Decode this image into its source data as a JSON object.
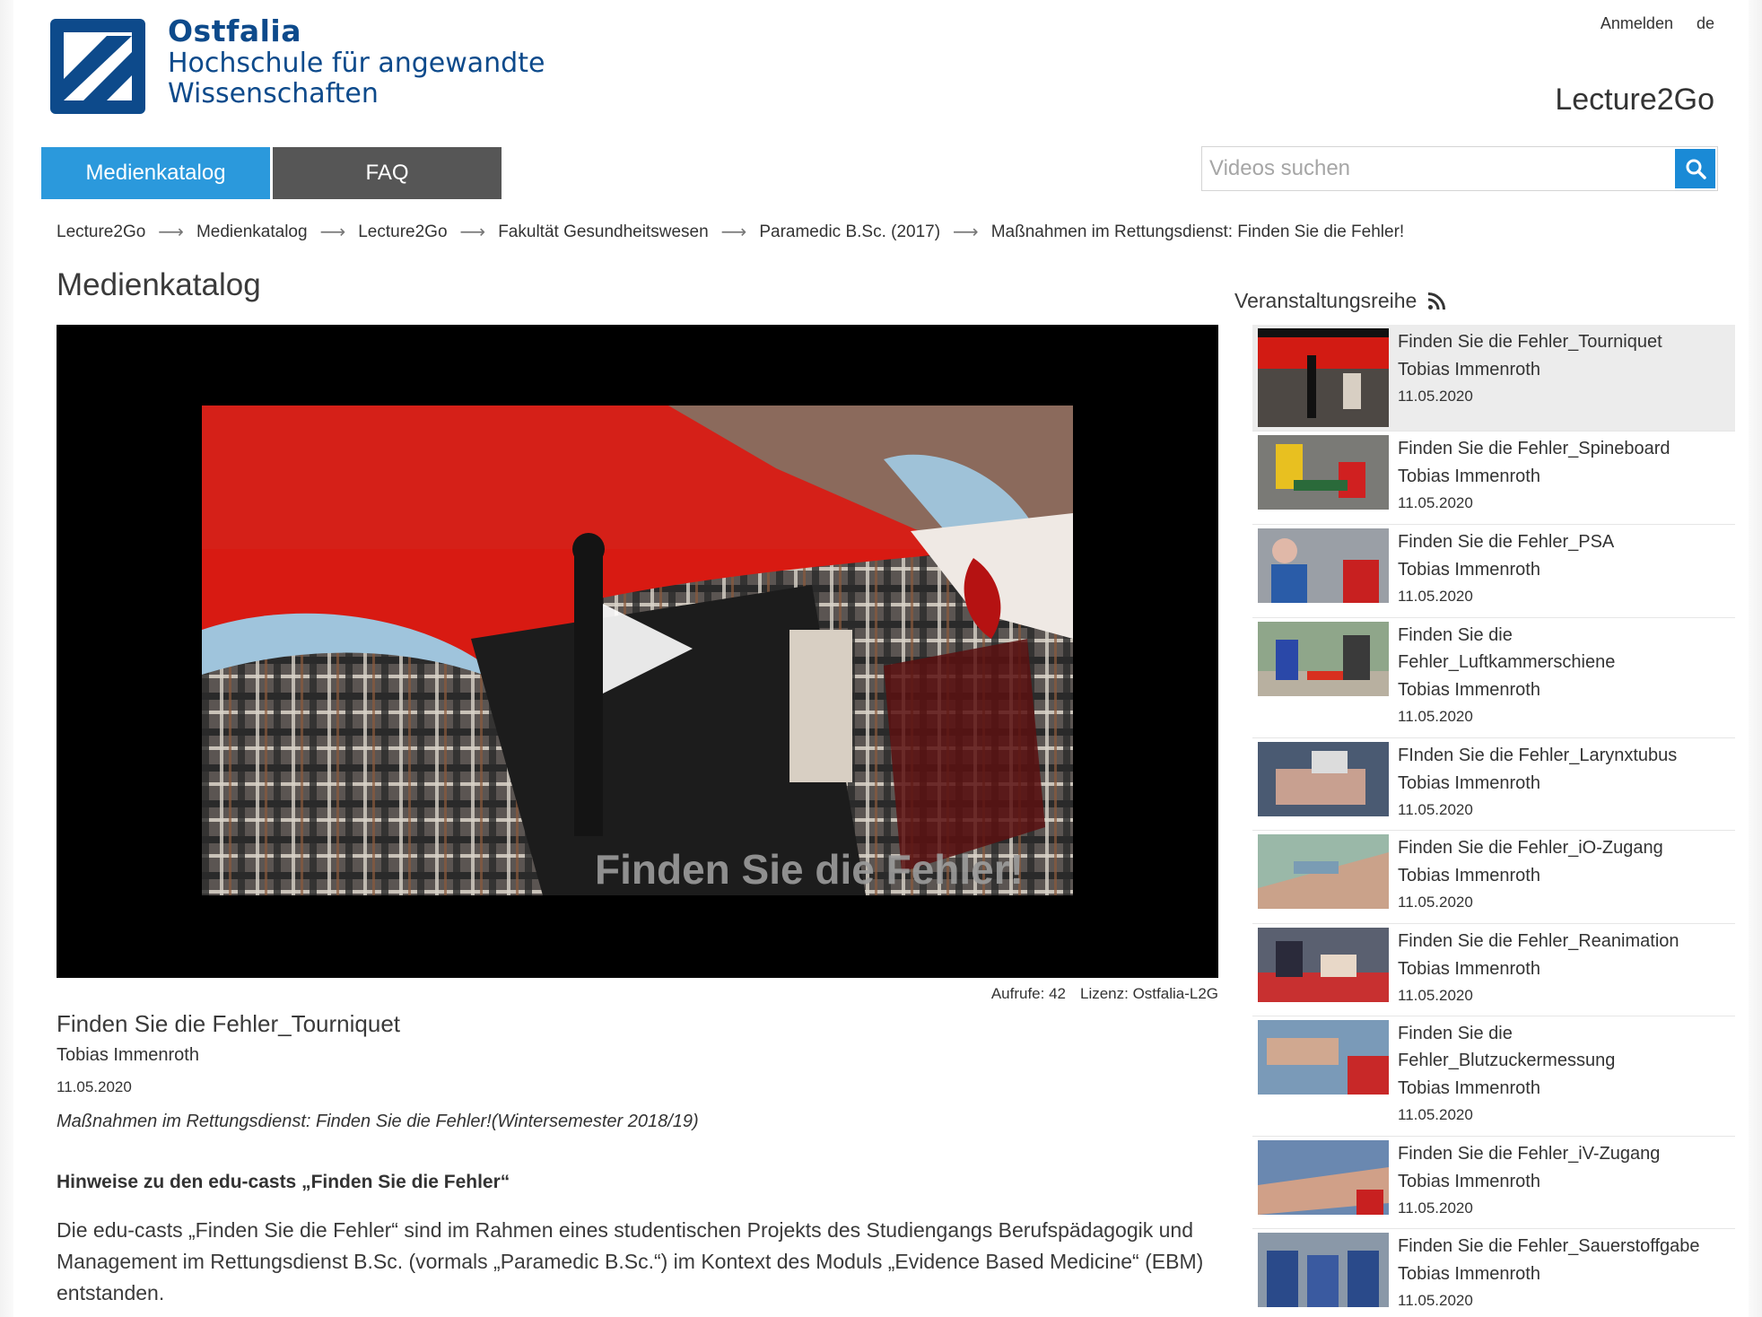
{
  "header": {
    "logo_line1": "Ostfalia",
    "logo_line2": "Hochschule für angewandte",
    "logo_line3": "Wissenschaften",
    "login_label": "Anmelden",
    "language_label": "de",
    "brand": "Lecture2Go"
  },
  "nav": {
    "items": [
      {
        "label": "Medienkatalog",
        "active": true
      },
      {
        "label": "FAQ",
        "active": false
      }
    ]
  },
  "search": {
    "placeholder": "Videos suchen",
    "value": ""
  },
  "breadcrumb": {
    "items": [
      "Lecture2Go",
      "Medienkatalog",
      "Lecture2Go",
      "Fakultät Gesundheitswesen",
      "Paramedic B.Sc. (2017)",
      "Maßnahmen im Rettungsdienst: Finden Sie die Fehler!"
    ],
    "separator": "⟶"
  },
  "main": {
    "title": "Medienkatalog",
    "player_overlay_text": "Finden Sie die Fehler!",
    "views_label": "Aufrufe: 42",
    "license_label": "Lizenz: Ostfalia-L2G",
    "video_title": "Finden Sie die Fehler_Tourniquet",
    "video_author": "Tobias Immenroth",
    "video_date": "11.05.2020",
    "video_series": "Maßnahmen im Rettungsdienst: Finden Sie die Fehler!(Wintersemester 2018/19)",
    "desc_heading": "Hinweise zu den edu-casts „Finden Sie die Fehler“",
    "desc_text": "Die edu-casts „Finden Sie die Fehler“ sind im Rahmen eines studentischen Projekts des Studiengangs Berufspädagogik und Management im Rettungsdienst B.Sc. (vormals „Paramedic B.Sc.“) im Kontext des Moduls „Evidence Based Medicine“ (EBM) entstanden."
  },
  "sidebar": {
    "title": "Veranstaltungsreihe",
    "items": [
      {
        "title": "Finden Sie die Fehler_Tourniquet",
        "author": "Tobias Immenroth",
        "date": "11.05.2020"
      },
      {
        "title": "Finden Sie die Fehler_Spineboard",
        "author": "Tobias Immenroth",
        "date": "11.05.2020"
      },
      {
        "title": "Finden Sie die Fehler_PSA",
        "author": "Tobias Immenroth",
        "date": "11.05.2020"
      },
      {
        "title": "Finden Sie die Fehler_Luftkammerschiene",
        "author": "Tobias Immenroth",
        "date": "11.05.2020"
      },
      {
        "title": "FInden Sie die Fehler_Larynxtubus",
        "author": "Tobias Immenroth",
        "date": "11.05.2020"
      },
      {
        "title": "Finden Sie die Fehler_iO-Zugang",
        "author": "Tobias Immenroth",
        "date": "11.05.2020"
      },
      {
        "title": "Finden Sie die Fehler_Reanimation",
        "author": "Tobias Immenroth",
        "date": "11.05.2020"
      },
      {
        "title": "Finden Sie die Fehler_Blutzuckermessung",
        "author": "Tobias Immenroth",
        "date": "11.05.2020"
      },
      {
        "title": "Finden Sie die Fehler_iV-Zugang",
        "author": "Tobias Immenroth",
        "date": "11.05.2020"
      },
      {
        "title": "Finden Sie die Fehler_Sauerstoffgabe",
        "author": "Tobias Immenroth",
        "date": "11.05.2020"
      }
    ]
  },
  "colors": {
    "accent": "#2b99dc",
    "nav_dark": "#565656",
    "logo_blue": "#0d4a8b",
    "search_button": "#1a8ad6"
  },
  "icons": {
    "search": "search-icon",
    "rss": "rss-icon",
    "play": "play-icon",
    "logo": "ostfalia-logo-icon"
  }
}
